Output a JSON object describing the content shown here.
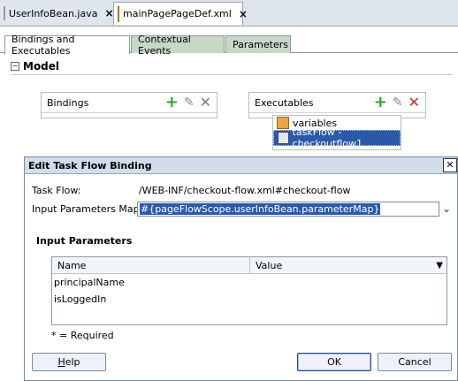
{
  "editor_tabs": [
    {
      "label": "UserInfoBean.java",
      "close": "×"
    },
    {
      "label": "mainPagePageDef.xml",
      "close": "×"
    }
  ],
  "subtabs": [
    "Bindings and Executables",
    "Contextual Events",
    "Parameters"
  ],
  "model": {
    "collapse": "−",
    "title": "Model"
  },
  "bindings": {
    "title": "Bindings"
  },
  "executables": {
    "title": "Executables",
    "items": [
      "variables",
      "taskFlow - checkoutflow1"
    ]
  },
  "dialog": {
    "title": "Edit Task Flow Binding",
    "close": "✕",
    "task_flow_label": "Task Flow:",
    "task_flow_value": "/WEB-INF/checkout-flow.xml#checkout-flow",
    "input_map_label": "Input Parameters Map:",
    "input_map_value": "#{pageFlowScope.userInfoBean.parameterMap}",
    "section_title": "Input Parameters",
    "columns": [
      "Name",
      "Value"
    ],
    "rows": [
      "principalName",
      "isLoggedIn"
    ],
    "required_note": "* = Required",
    "buttons": {
      "help_h": "H",
      "help_rest": "elp",
      "ok": "OK",
      "cancel": "Cancel"
    }
  },
  "colors": {
    "selection": "#2b59a9",
    "add": "#2fa12c",
    "delete": "#d2281d"
  }
}
